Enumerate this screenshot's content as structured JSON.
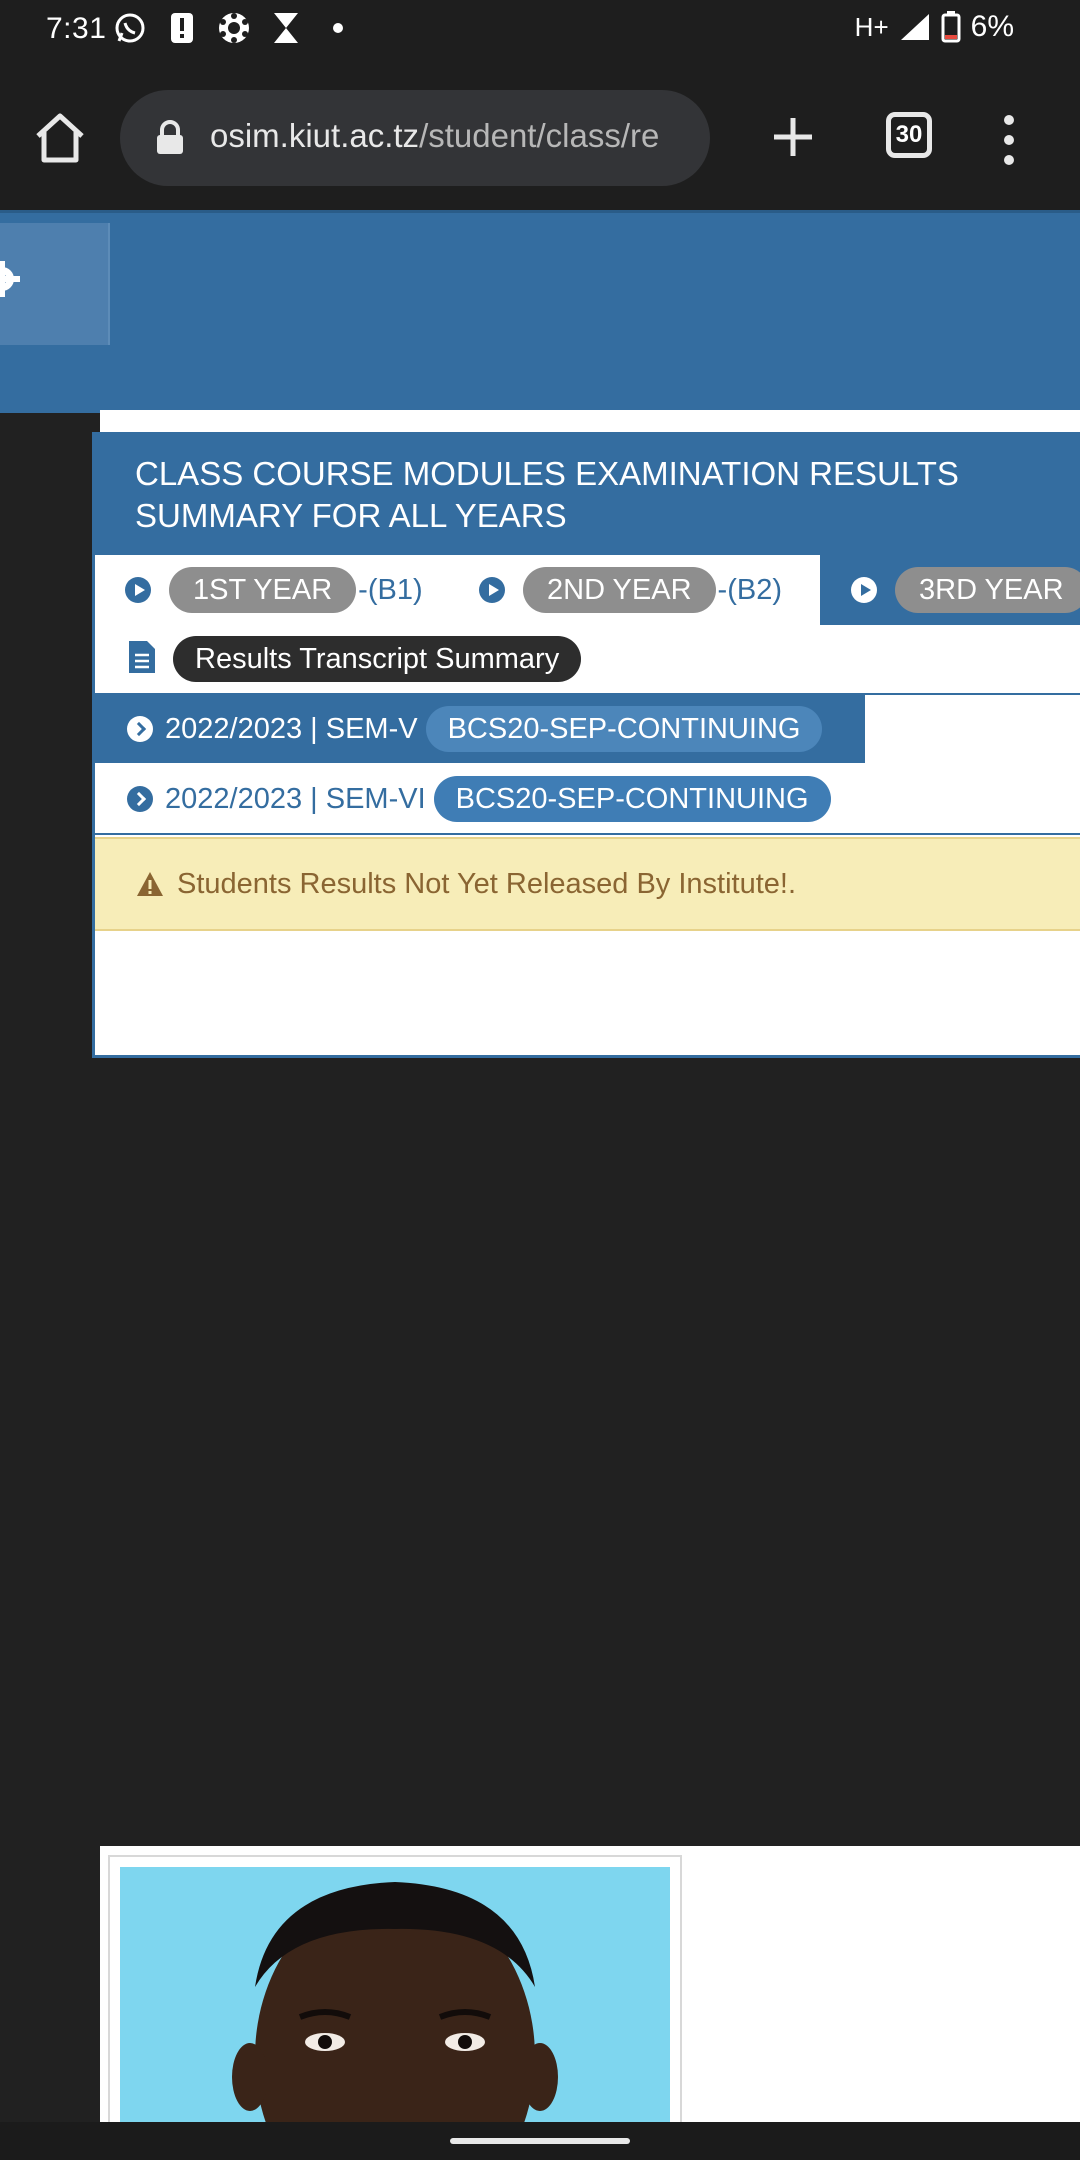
{
  "status_bar": {
    "time": "7:31",
    "network": "H+",
    "battery": "6%"
  },
  "browser": {
    "url_host": "osim.kiut.ac.tz",
    "url_path": "/student/class/re",
    "tab_count": "30"
  },
  "panel": {
    "title": "CLASS COURSE MODULES EXAMINATION RESULTS SUMMARY FOR ALL YEARS",
    "year_tabs": [
      {
        "label": "1ST YEAR",
        "suffix": "-(B1)"
      },
      {
        "label": "2ND YEAR",
        "suffix": "-(B2)"
      },
      {
        "label": "3RD YEAR",
        "suffix": ""
      }
    ],
    "transcript_label": "Results Transcript Summary",
    "semesters": [
      {
        "period": "2022/2023 | SEM-V",
        "badge": "BCS20-SEP-CONTINUING"
      },
      {
        "period": "2022/2023 | SEM-VI",
        "badge": "BCS20-SEP-CONTINUING"
      }
    ],
    "alert": "Students Results Not Yet Released By Institute!."
  },
  "colors": {
    "primary": "#346da0",
    "alert_bg": "#f7edb8",
    "alert_text": "#8a6532"
  }
}
